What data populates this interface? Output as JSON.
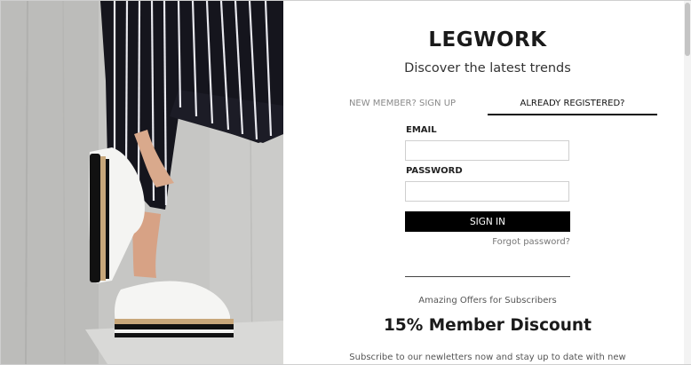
{
  "brand": {
    "name": "LEGWORK",
    "tagline": "Discover the latest trends"
  },
  "tabs": [
    {
      "label": "NEW MEMBER? SIGN UP",
      "active": false
    },
    {
      "label": "ALREADY REGISTERED?",
      "active": true
    }
  ],
  "form": {
    "email_label": "EMAIL",
    "email_value": "",
    "password_label": "PASSWORD",
    "password_value": "",
    "submit_label": "SIGN IN",
    "forgot_label": "Forgot password?"
  },
  "promo": {
    "intro": "Amazing Offers for Subscribers",
    "headline": "15% Member Discount",
    "body": "Subscribe to our newletters now and stay up to date with new"
  },
  "colors": {
    "primary": "#000000",
    "muted_text": "#8a8a8a",
    "background": "#ffffff"
  },
  "image": {
    "subject": "person in striped trousers wearing white platform brogues leaning against concrete wall"
  }
}
